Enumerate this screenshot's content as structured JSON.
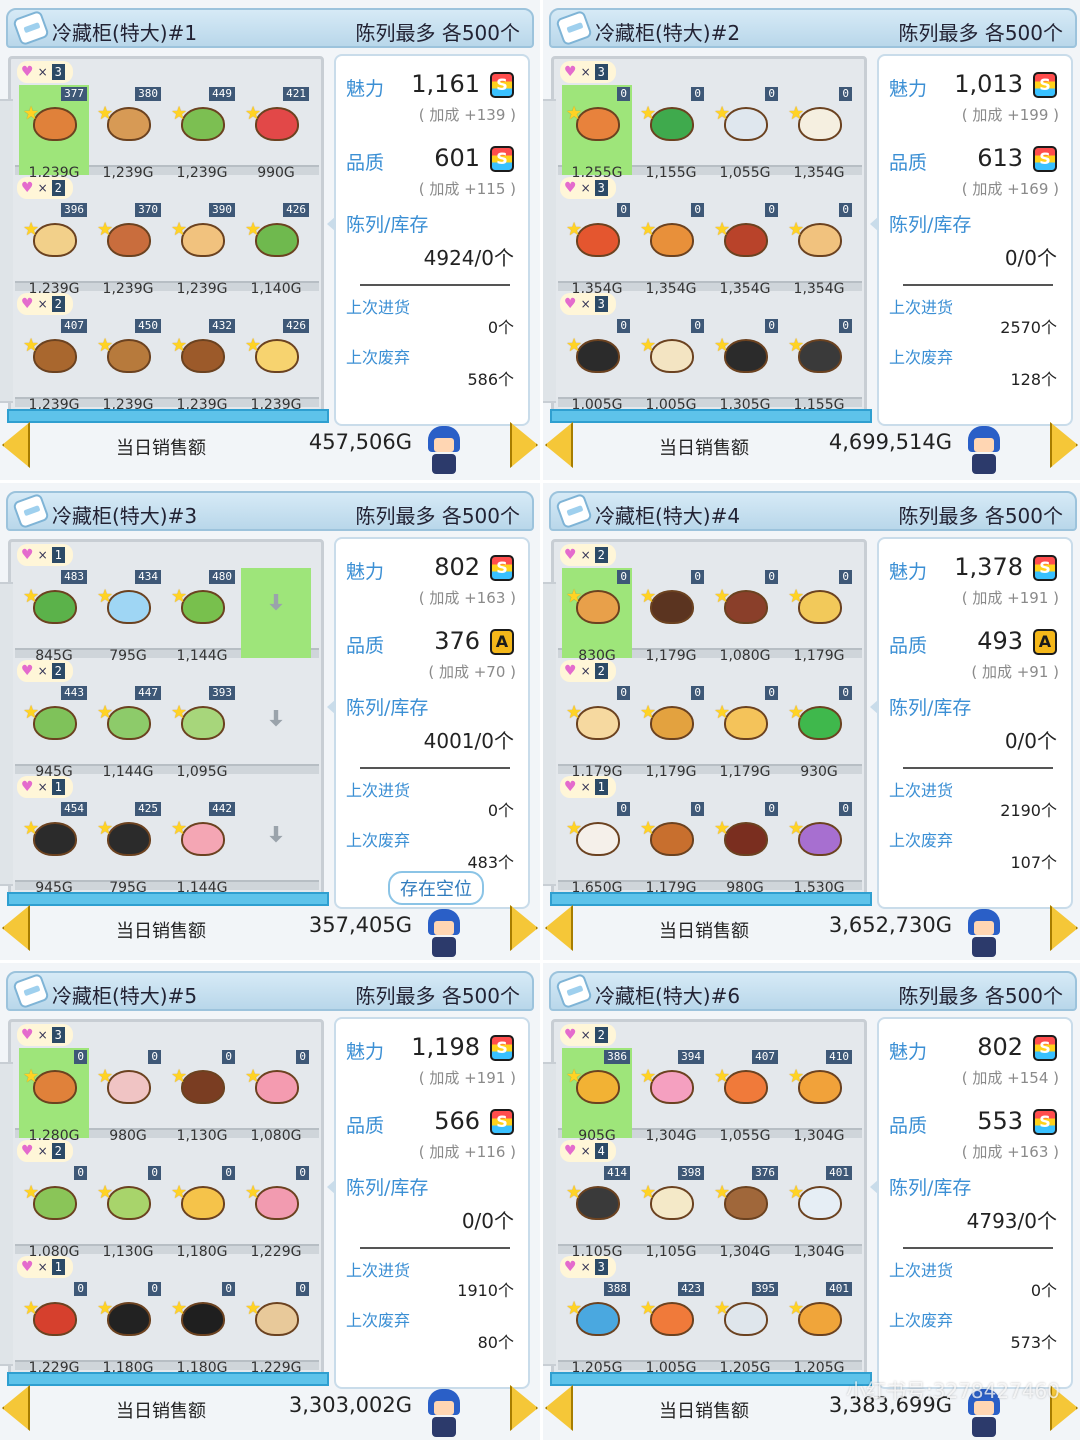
{
  "labels": {
    "capacity": "陈列最多  各500个",
    "charm": "魅力",
    "quality": "品质",
    "display_stock": "陈列/库存",
    "last_restock": "上次进货",
    "last_discard": "上次废弃",
    "daily_sales": "当日销售额"
  },
  "panels": [
    {
      "title": "冷藏柜(特大)#1",
      "charm": "1,161",
      "charm_bonus": "( 加成 +139 )",
      "charm_grade": "S",
      "quality": "601",
      "quality_bonus": "( 加成 +115 )",
      "quality_grade": "S",
      "stock": "4924/0个",
      "last_restock": "0个",
      "last_discard": "586个",
      "sales": "457,506G",
      "rows": [
        {
          "tag": "3",
          "slots": [
            {
              "num": "377",
              "price": "1,239G",
              "color": "#e0813a",
              "hl": true
            },
            {
              "num": "380",
              "price": "1,239G",
              "color": "#d79a55"
            },
            {
              "num": "449",
              "price": "1,239G",
              "color": "#7cbf52"
            },
            {
              "num": "421",
              "price": "990G",
              "color": "#e24848"
            }
          ]
        },
        {
          "tag": "2",
          "slots": [
            {
              "num": "396",
              "price": "1,239G",
              "color": "#f2d08a"
            },
            {
              "num": "370",
              "price": "1,239G",
              "color": "#c96d3d"
            },
            {
              "num": "390",
              "price": "1,239G",
              "color": "#f1c27e"
            },
            {
              "num": "426",
              "price": "1,140G",
              "color": "#6fb94e"
            }
          ]
        },
        {
          "tag": "2",
          "slots": [
            {
              "num": "407",
              "price": "1,239G",
              "color": "#a9672e"
            },
            {
              "num": "450",
              "price": "1,239G",
              "color": "#b77a3c"
            },
            {
              "num": "432",
              "price": "1,239G",
              "color": "#9c5a2a"
            },
            {
              "num": "426",
              "price": "1,239G",
              "color": "#f7d36f"
            }
          ]
        }
      ]
    },
    {
      "title": "冷藏柜(特大)#2",
      "charm": "1,013",
      "charm_bonus": "( 加成 +199 )",
      "charm_grade": "S",
      "quality": "613",
      "quality_bonus": "( 加成 +169 )",
      "quality_grade": "S",
      "stock": "0/0个",
      "last_restock": "2570个",
      "last_discard": "128个",
      "sales": "4,699,514G",
      "rows": [
        {
          "tag": "3",
          "slots": [
            {
              "num": "0",
              "price": "1,255G",
              "color": "#e8823c",
              "hl": true
            },
            {
              "num": "0",
              "price": "1,155G",
              "color": "#3faa4d"
            },
            {
              "num": "0",
              "price": "1,055G",
              "color": "#dfe7ee"
            },
            {
              "num": "0",
              "price": "1,354G",
              "color": "#f5efe0"
            }
          ]
        },
        {
          "tag": "3",
          "slots": [
            {
              "num": "0",
              "price": "1,354G",
              "color": "#e4562f"
            },
            {
              "num": "0",
              "price": "1,354G",
              "color": "#e8903a"
            },
            {
              "num": "0",
              "price": "1,354G",
              "color": "#b9432a"
            },
            {
              "num": "0",
              "price": "1,354G",
              "color": "#f1c27e"
            }
          ]
        },
        {
          "tag": "3",
          "slots": [
            {
              "num": "0",
              "price": "1,005G",
              "color": "#2b2b2b"
            },
            {
              "num": "0",
              "price": "1,005G",
              "color": "#f3e4c2"
            },
            {
              "num": "0",
              "price": "1,305G",
              "color": "#2b2b2b"
            },
            {
              "num": "0",
              "price": "1,155G",
              "color": "#3a3a3a"
            }
          ]
        }
      ]
    },
    {
      "title": "冷藏柜(特大)#3",
      "charm": "802",
      "charm_bonus": "( 加成 +163 )",
      "charm_grade": "S",
      "quality": "376",
      "quality_bonus": "( 加成 +70 )",
      "quality_grade": "A",
      "stock": "4001/0个",
      "last_restock": "0个",
      "last_discard": "483个",
      "sales": "357,405G",
      "empty_notice": "存在空位",
      "rows": [
        {
          "tag": "1",
          "slots": [
            {
              "num": "483",
              "price": "845G",
              "color": "#5bb24a"
            },
            {
              "num": "434",
              "price": "795G",
              "color": "#9fd6f4"
            },
            {
              "num": "480",
              "price": "1,144G",
              "color": "#78c04d"
            },
            {
              "num": "",
              "price": "",
              "color": "",
              "empty": true,
              "hl": true
            }
          ]
        },
        {
          "tag": "2",
          "slots": [
            {
              "num": "443",
              "price": "945G",
              "color": "#7fc25a"
            },
            {
              "num": "447",
              "price": "1,144G",
              "color": "#8dcb6a"
            },
            {
              "num": "393",
              "price": "1,095G",
              "color": "#a7d67b"
            },
            {
              "num": "",
              "price": "",
              "color": "",
              "empty": true
            }
          ]
        },
        {
          "tag": "1",
          "slots": [
            {
              "num": "454",
              "price": "945G",
              "color": "#2b2b2b"
            },
            {
              "num": "425",
              "price": "795G",
              "color": "#2b2b2b"
            },
            {
              "num": "442",
              "price": "1,144G",
              "color": "#f4a6b4"
            },
            {
              "num": "",
              "price": "",
              "color": "",
              "empty": true
            }
          ]
        }
      ]
    },
    {
      "title": "冷藏柜(特大)#4",
      "charm": "1,378",
      "charm_bonus": "( 加成 +191 )",
      "charm_grade": "S",
      "quality": "493",
      "quality_bonus": "( 加成 +91 )",
      "quality_grade": "A",
      "stock": "0/0个",
      "last_restock": "2190个",
      "last_discard": "107个",
      "sales": "3,652,730G",
      "rows": [
        {
          "tag": "2",
          "slots": [
            {
              "num": "0",
              "price": "830G",
              "color": "#e8a04a",
              "hl": true
            },
            {
              "num": "0",
              "price": "1,179G",
              "color": "#5b3420"
            },
            {
              "num": "0",
              "price": "1,080G",
              "color": "#8a3f2a"
            },
            {
              "num": "0",
              "price": "1,179G",
              "color": "#f2c95a"
            }
          ]
        },
        {
          "tag": "2",
          "slots": [
            {
              "num": "0",
              "price": "1,179G",
              "color": "#f6d9a0"
            },
            {
              "num": "0",
              "price": "1,179G",
              "color": "#e3a23f"
            },
            {
              "num": "0",
              "price": "1,179G",
              "color": "#f4c35a"
            },
            {
              "num": "0",
              "price": "930G",
              "color": "#3fb84c"
            }
          ]
        },
        {
          "tag": "1",
          "slots": [
            {
              "num": "0",
              "price": "1,650G",
              "color": "#f5f0ea"
            },
            {
              "num": "0",
              "price": "1,179G",
              "color": "#c86f2e"
            },
            {
              "num": "0",
              "price": "980G",
              "color": "#7a2e1f"
            },
            {
              "num": "0",
              "price": "1,530G",
              "color": "#a76fd0"
            }
          ]
        }
      ]
    },
    {
      "title": "冷藏柜(特大)#5",
      "charm": "1,198",
      "charm_bonus": "( 加成 +191 )",
      "charm_grade": "S",
      "quality": "566",
      "quality_bonus": "( 加成 +116 )",
      "quality_grade": "S",
      "stock": "0/0个",
      "last_restock": "1910个",
      "last_discard": "80个",
      "sales": "3,303,002G",
      "rows": [
        {
          "tag": "3",
          "slots": [
            {
              "num": "0",
              "price": "1,280G",
              "color": "#e0813a",
              "hl": true
            },
            {
              "num": "0",
              "price": "980G",
              "color": "#f0c4c4"
            },
            {
              "num": "0",
              "price": "1,130G",
              "color": "#7a3d22"
            },
            {
              "num": "0",
              "price": "1,080G",
              "color": "#f49bb0"
            }
          ]
        },
        {
          "tag": "2",
          "slots": [
            {
              "num": "0",
              "price": "1,080G",
              "color": "#8ac558"
            },
            {
              "num": "0",
              "price": "1,130G",
              "color": "#a8d46b"
            },
            {
              "num": "0",
              "price": "1,180G",
              "color": "#f5c34a"
            },
            {
              "num": "0",
              "price": "1,229G",
              "color": "#f29bb0"
            }
          ]
        },
        {
          "tag": "1",
          "slots": [
            {
              "num": "0",
              "price": "1,229G",
              "color": "#d6402d"
            },
            {
              "num": "0",
              "price": "1,180G",
              "color": "#222222"
            },
            {
              "num": "0",
              "price": "1,180G",
              "color": "#1f1f1f"
            },
            {
              "num": "0",
              "price": "1,229G",
              "color": "#e8c99a"
            }
          ]
        }
      ]
    },
    {
      "title": "冷藏柜(特大)#6",
      "charm": "802",
      "charm_bonus": "( 加成 +154 )",
      "charm_grade": "S",
      "quality": "553",
      "quality_bonus": "( 加成 +163 )",
      "quality_grade": "S",
      "stock": "4793/0个",
      "last_restock": "0个",
      "last_discard": "573个",
      "sales": "3,383,699G",
      "watermark": "小红书号:3278427460",
      "rows": [
        {
          "tag": "2",
          "slots": [
            {
              "num": "386",
              "price": "905G",
              "color": "#f2b234",
              "hl": true
            },
            {
              "num": "394",
              "price": "1,304G",
              "color": "#f5a0c0"
            },
            {
              "num": "407",
              "price": "1,055G",
              "color": "#f07a3a"
            },
            {
              "num": "410",
              "price": "1,304G",
              "color": "#f1a23a"
            }
          ]
        },
        {
          "tag": "4",
          "slots": [
            {
              "num": "414",
              "price": "1,105G",
              "color": "#3a3a3a"
            },
            {
              "num": "398",
              "price": "1,105G",
              "color": "#f4e9c8"
            },
            {
              "num": "376",
              "price": "1,304G",
              "color": "#a0673a"
            },
            {
              "num": "401",
              "price": "1,304G",
              "color": "#e6eef5"
            }
          ]
        },
        {
          "tag": "3",
          "slots": [
            {
              "num": "388",
              "price": "1,205G",
              "color": "#4aa8e0"
            },
            {
              "num": "423",
              "price": "1,005G",
              "color": "#f07a3a"
            },
            {
              "num": "395",
              "price": "1,205G",
              "color": "#dfe6ec"
            },
            {
              "num": "401",
              "price": "1,205G",
              "color": "#f0a53a"
            }
          ]
        }
      ]
    }
  ]
}
